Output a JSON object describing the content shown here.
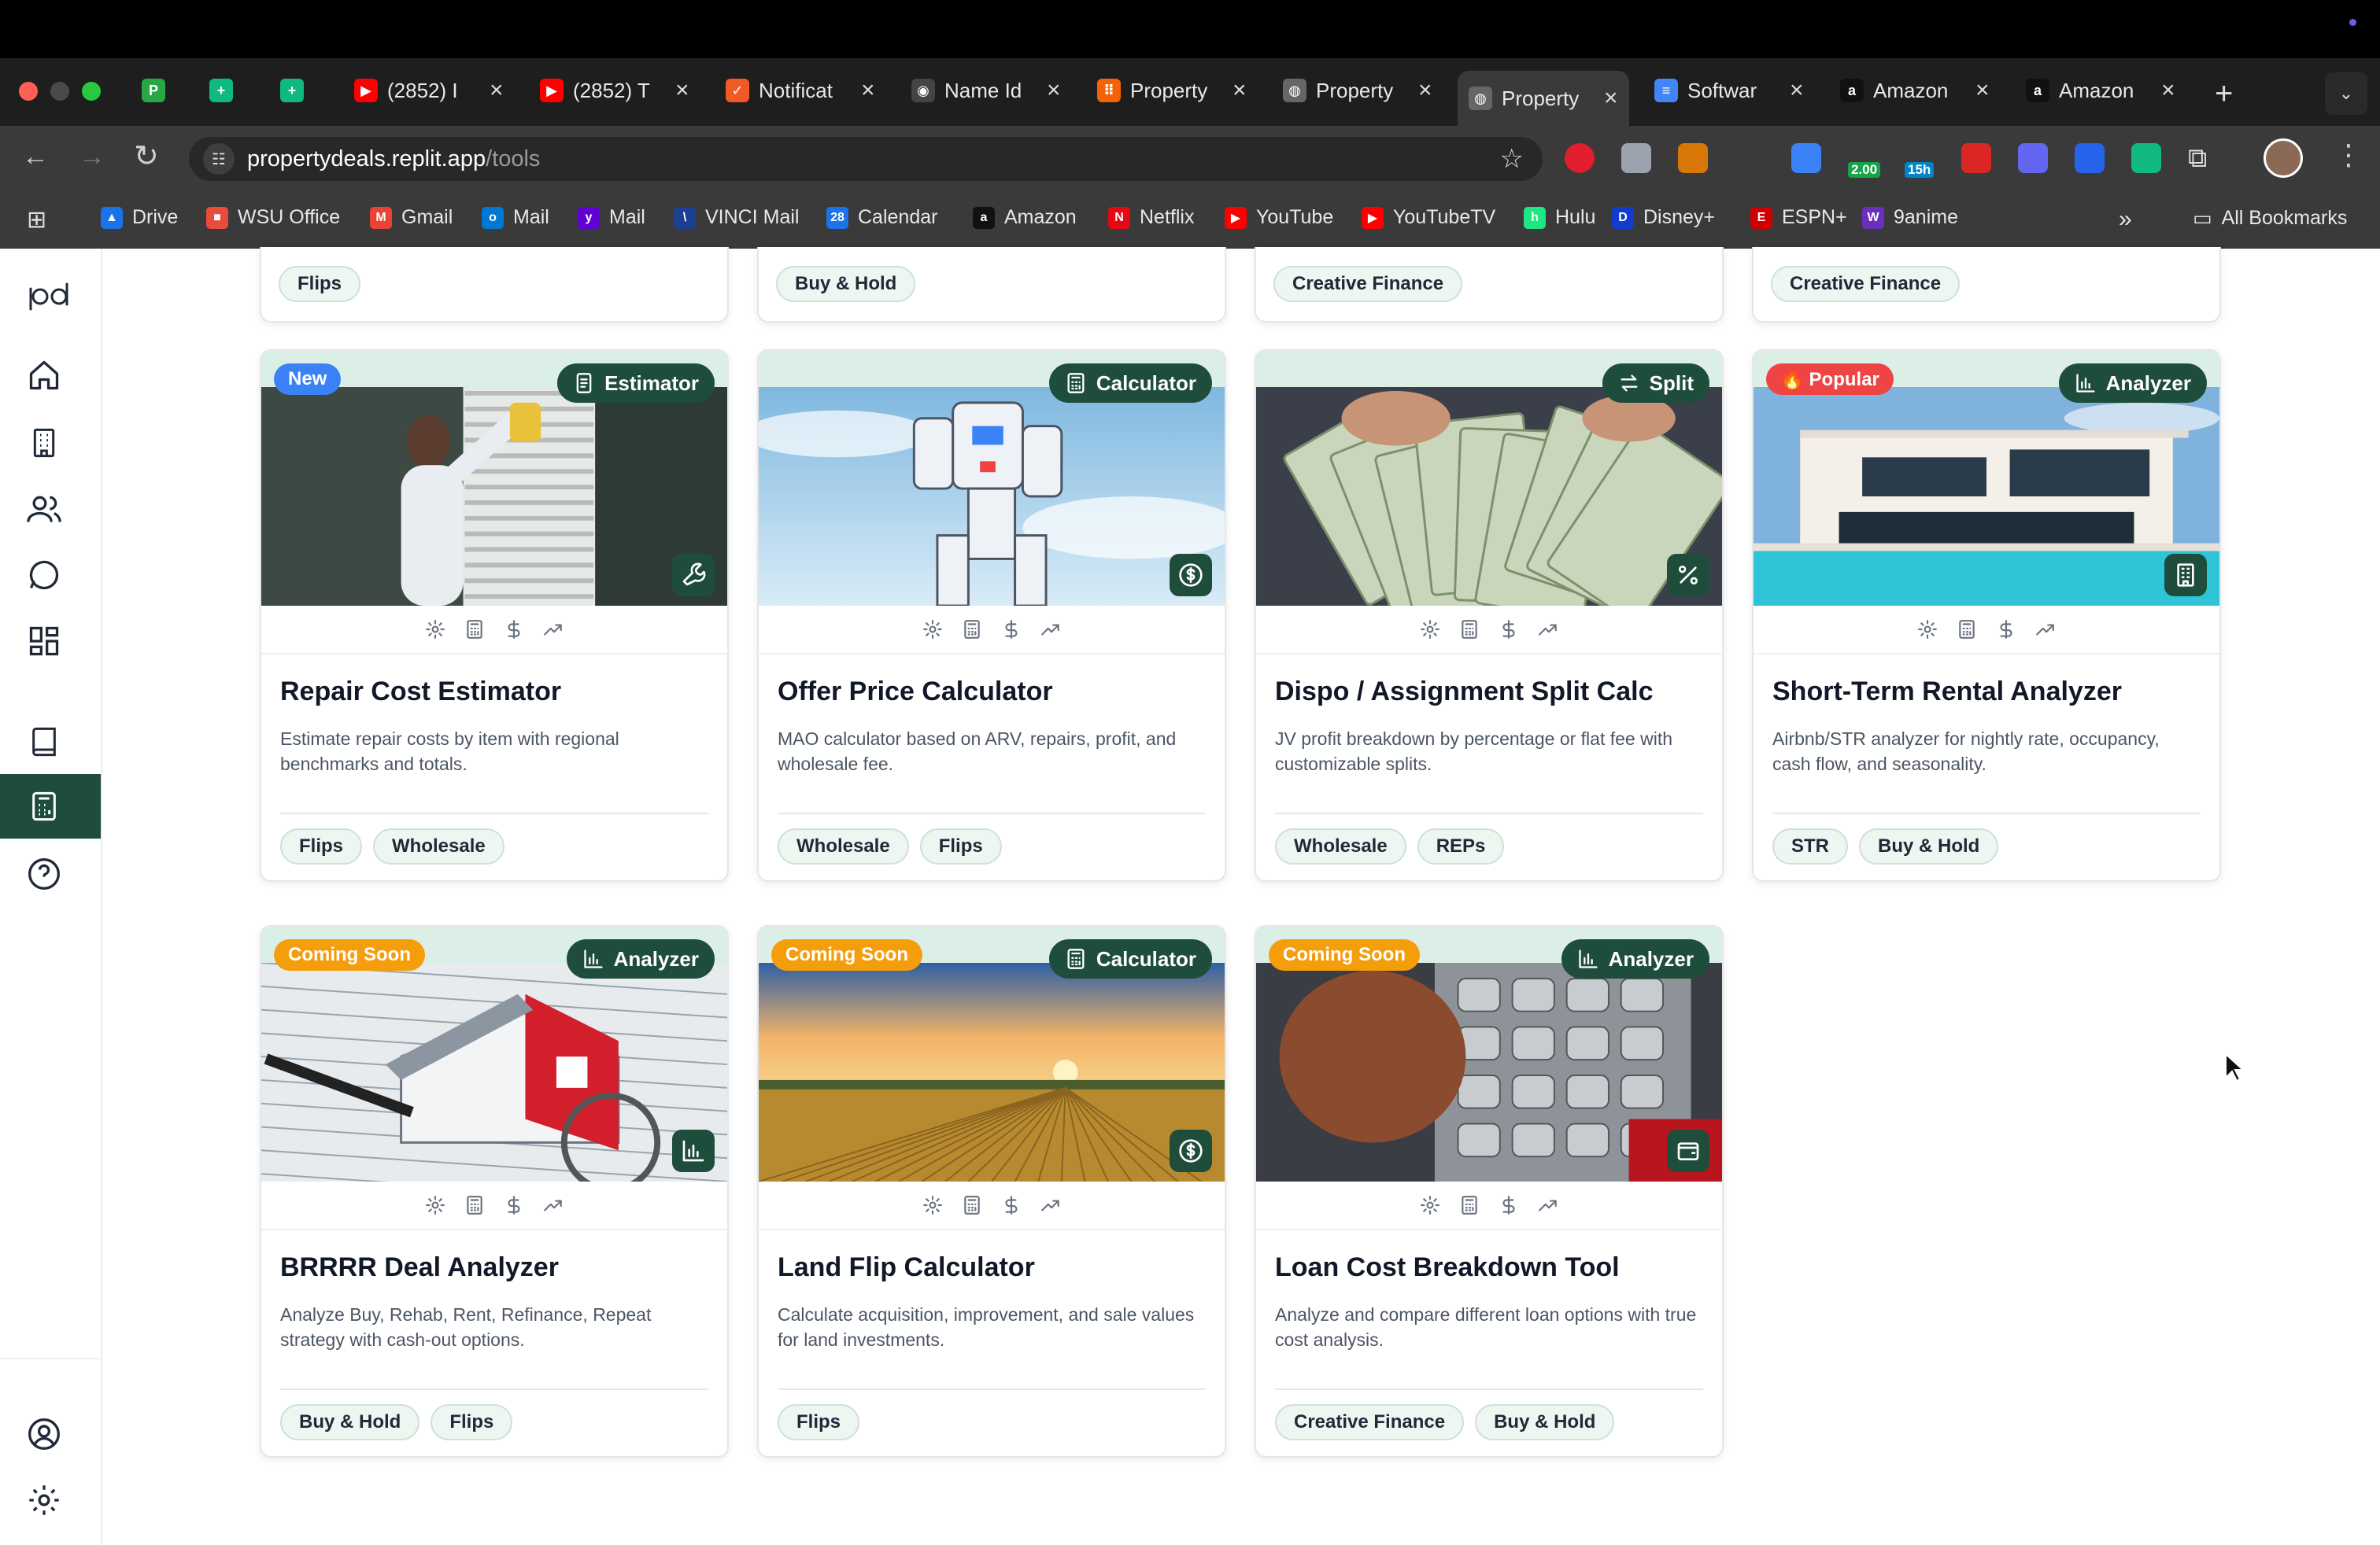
{
  "browser": {
    "tabs": [
      {
        "title": "P",
        "favicon": "P",
        "color": "#27a745",
        "pinned": true
      },
      {
        "title": "",
        "favicon": "+",
        "color": "#10b981",
        "pinned": true
      },
      {
        "title": "",
        "favicon": "+",
        "color": "#10b981",
        "pinned": true
      },
      {
        "title": "(2852) I",
        "favicon": "▶",
        "color": "#ff0000"
      },
      {
        "title": "(2852) T",
        "favicon": "▶",
        "color": "#ff0000"
      },
      {
        "title": "Notificat",
        "favicon": "✓",
        "color": "#f15a24"
      },
      {
        "title": "Name Id",
        "favicon": "◉",
        "color": "#444444"
      },
      {
        "title": "Property",
        "favicon": "⠿",
        "color": "#f26207"
      },
      {
        "title": "Property",
        "favicon": "◍",
        "color": "#666666"
      },
      {
        "title": "Property",
        "favicon": "◍",
        "color": "#666666",
        "active": true
      },
      {
        "title": "Softwar",
        "favicon": "≡",
        "color": "#4285f4"
      },
      {
        "title": "Amazon",
        "favicon": "a",
        "color": "#111111"
      },
      {
        "title": "Amazon",
        "favicon": "a",
        "color": "#111111"
      }
    ],
    "url_host": "propertydeals.replit.app",
    "url_path": "/tools",
    "extension_badges": {
      "one": "2.00",
      "two": "15h"
    },
    "bookmarks": [
      {
        "label": "Drive",
        "color": "#1a73e8",
        "glyph": "▲"
      },
      {
        "label": "WSU Office",
        "color": "#e74c3c",
        "glyph": "■"
      },
      {
        "label": "Gmail",
        "color": "#ea4335",
        "glyph": "M"
      },
      {
        "label": "Mail",
        "color": "#0078d4",
        "glyph": "o"
      },
      {
        "label": "Mail",
        "color": "#6001d2",
        "glyph": "y"
      },
      {
        "label": "VINCI Mail",
        "color": "#1c3f94",
        "glyph": "\\"
      },
      {
        "label": "Calendar",
        "color": "#1a73e8",
        "glyph": "28"
      },
      {
        "label": "Amazon",
        "color": "#111111",
        "glyph": "a"
      },
      {
        "label": "Netflix",
        "color": "#e50914",
        "glyph": "N"
      },
      {
        "label": "YouTube",
        "color": "#ff0000",
        "glyph": "▶"
      },
      {
        "label": "YouTubeTV",
        "color": "#ff0000",
        "glyph": "▶"
      },
      {
        "label": "Hulu",
        "color": "#1ce783",
        "glyph": "h"
      },
      {
        "label": "Disney+",
        "color": "#113ccf",
        "glyph": "D"
      },
      {
        "label": "ESPN+",
        "color": "#d00000",
        "glyph": "E"
      },
      {
        "label": "9anime",
        "color": "#6b2fbf",
        "glyph": "W"
      }
    ],
    "all_bookmarks_label": "All Bookmarks"
  },
  "top_row_tags": [
    [
      "Flips"
    ],
    [
      "Buy & Hold"
    ],
    [
      "Creative Finance"
    ],
    [
      "Creative Finance"
    ]
  ],
  "cards": [
    {
      "title": "Repair Cost Estimator",
      "description": "Estimate repair costs by item with regional benchmarks and totals.",
      "badge": "New",
      "badge_color": "#3b82f6",
      "type": "Estimator",
      "type_icon": "document-icon",
      "corner_icon": "wrench-icon",
      "tags": [
        "Flips",
        "Wholesale"
      ],
      "image": "cleaning-window"
    },
    {
      "title": "Offer Price Calculator",
      "description": "MAO calculator based on ARV, repairs, profit, and wholesale fee.",
      "badge": "",
      "type": "Calculator",
      "type_icon": "calculator-icon",
      "corner_icon": "dollar-circle-icon",
      "tags": [
        "Wholesale",
        "Flips"
      ],
      "image": "robot-sky"
    },
    {
      "title": "Dispo / Assignment Split Calc",
      "description": "JV profit breakdown by percentage or flat fee with customizable splits.",
      "badge": "",
      "type": "Split",
      "type_icon": "swap-arrows-icon",
      "corner_icon": "percent-icon",
      "tags": [
        "Wholesale",
        "REPs"
      ],
      "image": "cash-hands"
    },
    {
      "title": "Short-Term Rental Analyzer",
      "description": "Airbnb/STR analyzer for nightly rate, occupancy, cash flow, and seasonality.",
      "badge": "🔥 Popular",
      "badge_color": "#ef4444",
      "type": "Analyzer",
      "type_icon": "bar-chart-icon",
      "corner_icon": "building-icon",
      "tags": [
        "STR",
        "Buy & Hold"
      ],
      "image": "modern-villa"
    },
    {
      "title": "BRRRR Deal Analyzer",
      "description": "Analyze Buy, Rehab, Rent, Refinance, Repeat strategy with cash-out options.",
      "badge": "Coming Soon",
      "badge_color": "#f59e0b",
      "type": "Analyzer",
      "type_icon": "bar-chart-icon",
      "corner_icon": "bar-chart-icon",
      "tags": [
        "Buy & Hold",
        "Flips"
      ],
      "image": "house-model"
    },
    {
      "title": "Land Flip Calculator",
      "description": "Calculate acquisition, improvement, and sale values for land investments.",
      "badge": "Coming Soon",
      "badge_color": "#f59e0b",
      "type": "Calculator",
      "type_icon": "calculator-icon",
      "corner_icon": "dollar-circle-icon",
      "tags": [
        "Flips"
      ],
      "image": "field-sunset"
    },
    {
      "title": "Loan Cost Breakdown Tool",
      "description": "Analyze and compare different loan options with true cost analysis.",
      "badge": "Coming Soon",
      "badge_color": "#f59e0b",
      "type": "Analyzer",
      "type_icon": "bar-chart-icon",
      "corner_icon": "wallet-icon",
      "tags": [
        "Creative Finance",
        "Buy & Hold"
      ],
      "image": "atm-keypad"
    }
  ],
  "feature_icons": [
    "gear-icon",
    "calculator-icon",
    "dollar-icon",
    "trend-up-icon"
  ],
  "sidebar": {
    "logo": "pd",
    "items": [
      "home",
      "building",
      "users",
      "chat",
      "grid",
      "book",
      "calculator",
      "help"
    ],
    "active": "calculator",
    "bottom": [
      "profile",
      "settings"
    ]
  }
}
